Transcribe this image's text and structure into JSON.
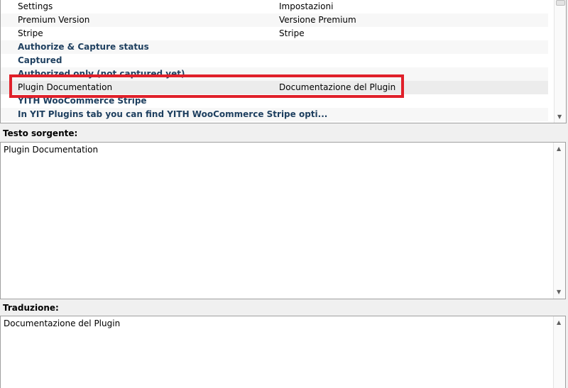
{
  "list": {
    "rows": [
      {
        "source": "Settings",
        "translation": "Impostazioni"
      },
      {
        "source": "Premium Version",
        "translation": "Versione Premium"
      },
      {
        "source": "Stripe",
        "translation": "Stripe"
      },
      {
        "source": "Authorize & Capture status",
        "translation": ""
      },
      {
        "source": "Captured",
        "translation": ""
      },
      {
        "source": "Authorized only (not captured yet)",
        "translation": ""
      },
      {
        "source": "Plugin Documentation",
        "translation": "Documentazione del Plugin"
      },
      {
        "source": "YITH WooCommerce Stripe",
        "translation": ""
      },
      {
        "source": "In YIT Plugins tab you can find YITH WooCommerce Stripe opti...",
        "translation": ""
      }
    ]
  },
  "source_section": {
    "label": "Testo sorgente:",
    "text": "Plugin Documentation"
  },
  "translation_section": {
    "label": "Traduzione:",
    "text": "Documentazione del Plugin"
  },
  "colors": {
    "highlight": "#e0202a",
    "untranslated_text": "#1e3f5f"
  }
}
